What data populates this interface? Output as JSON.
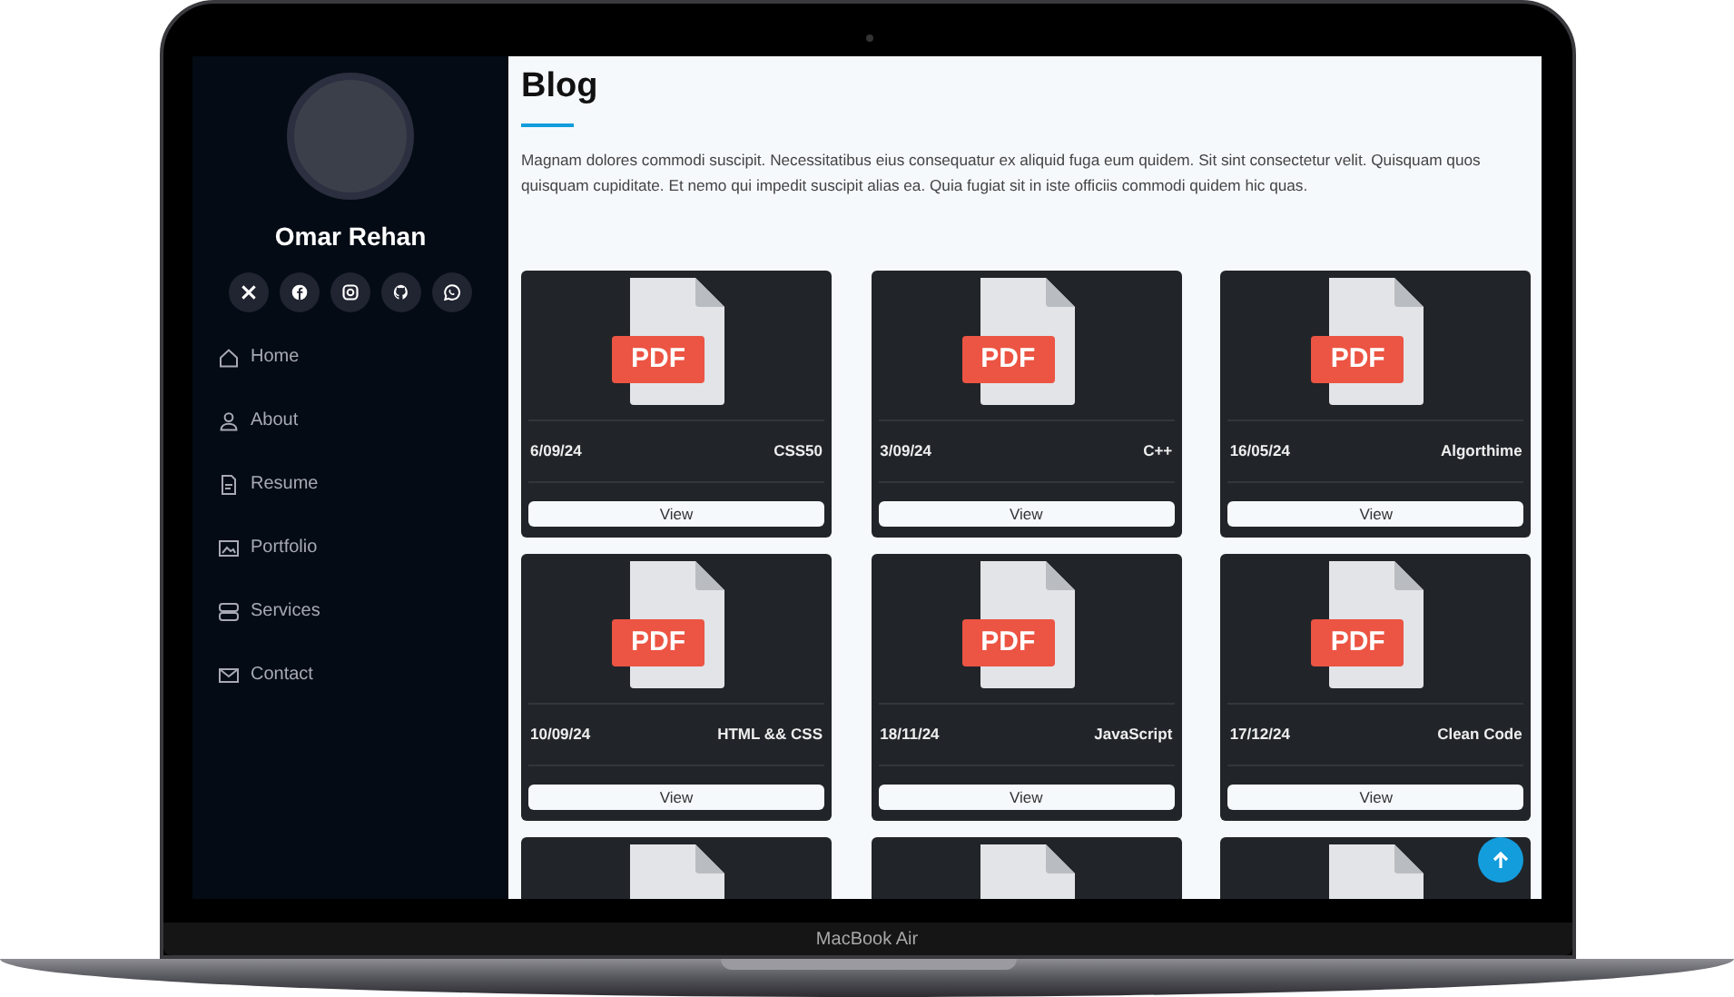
{
  "device": {
    "label": "MacBook Air"
  },
  "sidebar": {
    "name": "Omar Rehan",
    "social_links": [
      {
        "kind": "x"
      },
      {
        "kind": "facebook"
      },
      {
        "kind": "instagram"
      },
      {
        "kind": "github"
      },
      {
        "kind": "whatsapp"
      }
    ],
    "nav_items": [
      {
        "label": "Home",
        "kind": "home"
      },
      {
        "label": "About",
        "kind": "person"
      },
      {
        "label": "Resume",
        "kind": "file"
      },
      {
        "label": "Portfolio",
        "kind": "picture"
      },
      {
        "label": "Services",
        "kind": "server"
      },
      {
        "label": "Contact",
        "kind": "envelope"
      }
    ]
  },
  "main": {
    "title": "Blog",
    "description": "Magnam dolores commodi suscipit. Necessitatibus eius consequatur ex aliquid fuga eum quidem. Sit sint consectetur velit. Quisquam quos quisquam cupiditate. Et nemo qui impedit suscipit alias ea. Quia fugiat sit in iste officiis commodi quidem hic quas.",
    "posts": [
      {
        "kind": "full",
        "file_label": "PDF",
        "date": "6/09/24",
        "tag": "CSS50",
        "button": "View"
      },
      {
        "kind": "full",
        "file_label": "PDF",
        "date": "3/09/24",
        "tag": "C++",
        "button": "View"
      },
      {
        "kind": "full",
        "file_label": "PDF",
        "date": "16/05/24",
        "tag": "Algorthime",
        "button": "View"
      },
      {
        "kind": "full",
        "file_label": "PDF",
        "date": "10/09/24",
        "tag": "HTML && CSS",
        "button": "View"
      },
      {
        "kind": "full",
        "file_label": "PDF",
        "date": "18/11/24",
        "tag": "JavaScript",
        "button": "View"
      },
      {
        "kind": "full",
        "file_label": "PDF",
        "date": "17/12/24",
        "tag": "Clean Code",
        "button": "View"
      },
      {
        "kind": "partial"
      },
      {
        "kind": "partial"
      },
      {
        "kind": "partial"
      }
    ]
  }
}
